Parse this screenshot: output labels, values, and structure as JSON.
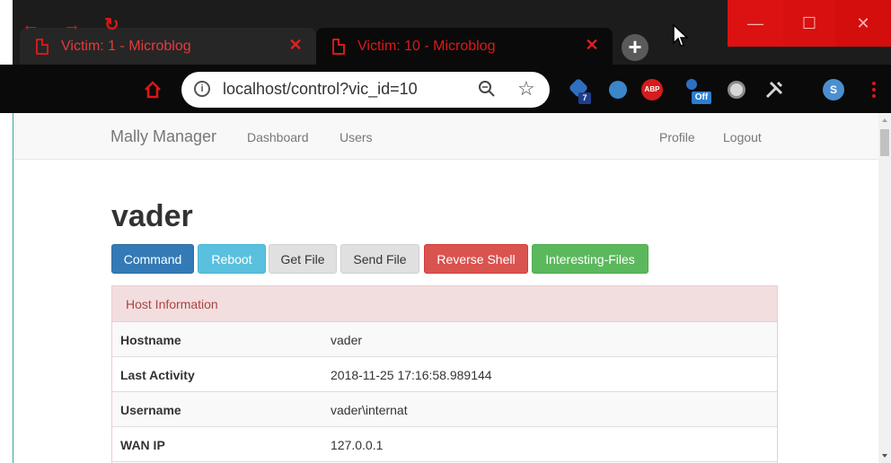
{
  "browser": {
    "tabs": [
      {
        "title": "Victim: 1 - Microblog",
        "active": false
      },
      {
        "title": "Victim: 10 - Microblog",
        "active": true
      }
    ],
    "url": "localhost/control?vic_id=10",
    "extensions": [
      {
        "name": "extension-badge-icon",
        "badge": "7"
      },
      {
        "name": "vimeo-icon",
        "badge": ""
      },
      {
        "name": "adblock-icon",
        "badge": "ABP"
      },
      {
        "name": "off-extension-icon",
        "badge": "Off"
      },
      {
        "name": "circle-extension-icon",
        "badge": ""
      },
      {
        "name": "tools-icon",
        "badge": ""
      },
      {
        "name": "profile-avatar-icon",
        "badge": "S"
      },
      {
        "name": "kebab-menu-icon",
        "badge": ""
      }
    ],
    "accent_color": "#e01515"
  },
  "navbar": {
    "brand": "Mally Manager",
    "links": [
      "Dashboard",
      "Users"
    ],
    "right_links": [
      "Profile",
      "Logout"
    ]
  },
  "main": {
    "title": "vader",
    "actions": [
      "Command",
      "Reboot",
      "Get File",
      "Send File",
      "Reverse Shell",
      "Interesting-Files"
    ]
  },
  "host_panel": {
    "heading": "Host Information",
    "rows": [
      {
        "key": "Hostname",
        "value": "vader"
      },
      {
        "key": "Last Activity",
        "value": "2018-11-25 17:16:58.989144"
      },
      {
        "key": "Username",
        "value": "vader\\internat"
      },
      {
        "key": "WAN IP",
        "value": "127.0.0.1"
      }
    ]
  }
}
